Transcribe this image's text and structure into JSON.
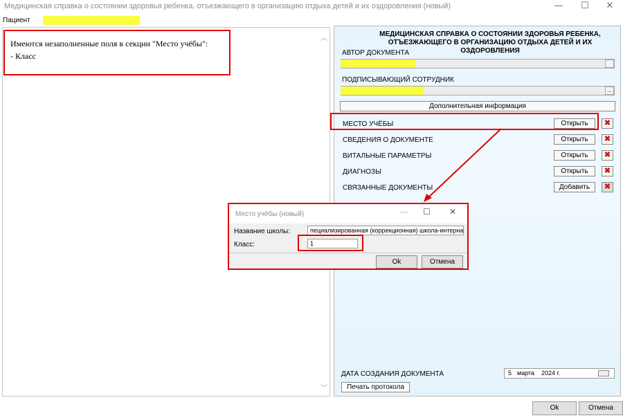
{
  "window": {
    "title": "Медицинская справка о состоянии здоровья ребенка, отъезжающего в организацию отдыха детей и их оздоровления (новый)",
    "minimize_glyph": "—",
    "maximize_glyph": "☐",
    "close_glyph": "✕"
  },
  "patient": {
    "label": "Пациент"
  },
  "message": {
    "line1": "Имеются незаполненные поля в секции \"Место учёбы\":",
    "line2": "- Класс"
  },
  "document": {
    "title_line1": "МЕДИЦИНСКАЯ СПРАВКА О СОСТОЯНИИ ЗДОРОВЬЯ РЕБЕНКА,",
    "title_line2": "ОТЪЕЗЖАЮЩЕГО В ОРГАНИЗАЦИЮ ОТДЫХА ДЕТЕЙ И ИХ ОЗДОРОВЛЕНИЯ",
    "author_label": "АВТОР ДОКУМЕНТА",
    "signer_label": "ПОДПИСЫВАЮЩИЙ СОТРУДНИК",
    "browse_glyph": "...",
    "additional_info_label": "Дополнительная информация",
    "sections": [
      {
        "label": "МЕСТО УЧЁБЫ",
        "action": "Открыть"
      },
      {
        "label": "СВЕДЕНИЯ О ДОКУМЕНТЕ",
        "action": "Открыть"
      },
      {
        "label": "ВИТАЛЬНЫЕ ПАРАМЕТРЫ",
        "action": "Открыть"
      },
      {
        "label": "ДИАГНОЗЫ",
        "action": "Открыть"
      },
      {
        "label": "СВЯЗАННЫЕ ДОКУМЕНТЫ",
        "action": "Добавить"
      }
    ],
    "delete_glyph": "✖",
    "creation_date_label": "ДАТА СОЗДАНИЯ ДОКУМЕНТА",
    "creation_date": {
      "day": "5",
      "month": "марта",
      "year": "2024 г."
    },
    "print_protocol_label": "Печать протокола"
  },
  "dialog": {
    "title": "Место учёбы (новый)",
    "school_label": "Название школы:",
    "school_value": "пециализированная (коррекционная) школа-интернат\"",
    "class_label": "Класс:",
    "class_value": "1",
    "ok_label": "Ok",
    "cancel_label": "Отмена"
  },
  "footer": {
    "ok_label": "Ok",
    "cancel_label": "Отмена"
  },
  "colors": {
    "annotation": "#e00000",
    "highlight": "#fbff2a",
    "panel_bg": "#e6f4fd"
  }
}
